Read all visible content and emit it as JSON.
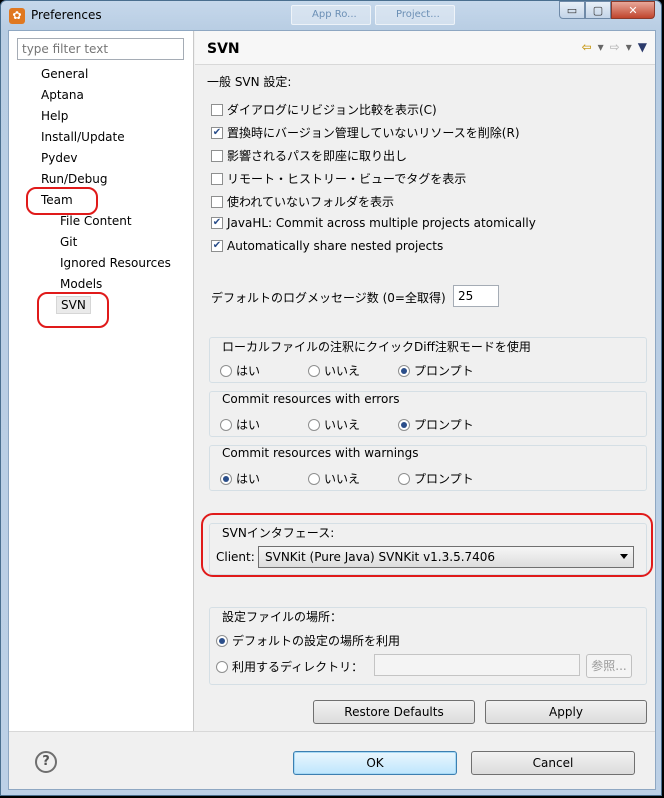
{
  "window": {
    "title": "Preferences",
    "bg_tabs": [
      "App Ro...",
      "Project..."
    ],
    "controls": {
      "minimize": "▭",
      "maximize": "▢",
      "close": "✕"
    }
  },
  "filter": {
    "placeholder": "type filter text"
  },
  "tree": {
    "items": [
      {
        "label": "General",
        "level": 1
      },
      {
        "label": "Aptana",
        "level": 1
      },
      {
        "label": "Help",
        "level": 1
      },
      {
        "label": "Install/Update",
        "level": 1
      },
      {
        "label": "Pydev",
        "level": 1
      },
      {
        "label": "Run/Debug",
        "level": 1
      },
      {
        "label": "Team",
        "level": 1
      },
      {
        "label": "File Content",
        "level": 2
      },
      {
        "label": "Git",
        "level": 2
      },
      {
        "label": "Ignored Resources",
        "level": 2
      },
      {
        "label": "Models",
        "level": 2
      },
      {
        "label": "SVN",
        "level": 2,
        "selected": true
      }
    ]
  },
  "page": {
    "title": "SVN",
    "general_label": "一般 SVN 設定:",
    "checkboxes": [
      {
        "label": "ダイアログにリビジョン比較を表示(C)",
        "checked": false
      },
      {
        "label": "置換時にバージョン管理していないリソースを削除(R)",
        "checked": true
      },
      {
        "label": "影響されるパスを即座に取り出し",
        "checked": false
      },
      {
        "label": "リモート・ヒストリー・ビューでタグを表示",
        "checked": false
      },
      {
        "label": "使われていないフォルダを表示",
        "checked": false
      },
      {
        "label": "JavaHL: Commit across multiple projects atomically",
        "checked": true
      },
      {
        "label": "Automatically share nested projects",
        "checked": true
      }
    ],
    "log_count_label": "デフォルトのログメッセージ数 (0=全取得)",
    "log_count_value": "25",
    "radio_groups": [
      {
        "title": "ローカルファイルの注釈にクイックDiff注釈モードを使用",
        "options": [
          "はい",
          "いいえ",
          "プロンプト"
        ],
        "selected": 2
      },
      {
        "title": "Commit resources with errors",
        "options": [
          "はい",
          "いいえ",
          "プロンプト"
        ],
        "selected": 2
      },
      {
        "title": "Commit resources with warnings",
        "options": [
          "はい",
          "いいえ",
          "プロンプト"
        ],
        "selected": 0
      }
    ],
    "svn_interface": {
      "title": "SVNインタフェース:",
      "client_label": "Client:",
      "client_value": "SVNKit (Pure Java) SVNKit v1.3.5.7406"
    },
    "config_location": {
      "title": "設定ファイルの場所：",
      "option_default": "デフォルトの設定の場所を利用",
      "option_dir": "利用するディレクトリ：",
      "browse": "参照..."
    },
    "restore_defaults": "Restore Defaults",
    "apply": "Apply"
  },
  "dialog": {
    "ok": "OK",
    "cancel": "Cancel",
    "help": "?"
  },
  "colors": {
    "highlight_oval": "#e01a1a",
    "checkmark": "#2b4e8a"
  }
}
